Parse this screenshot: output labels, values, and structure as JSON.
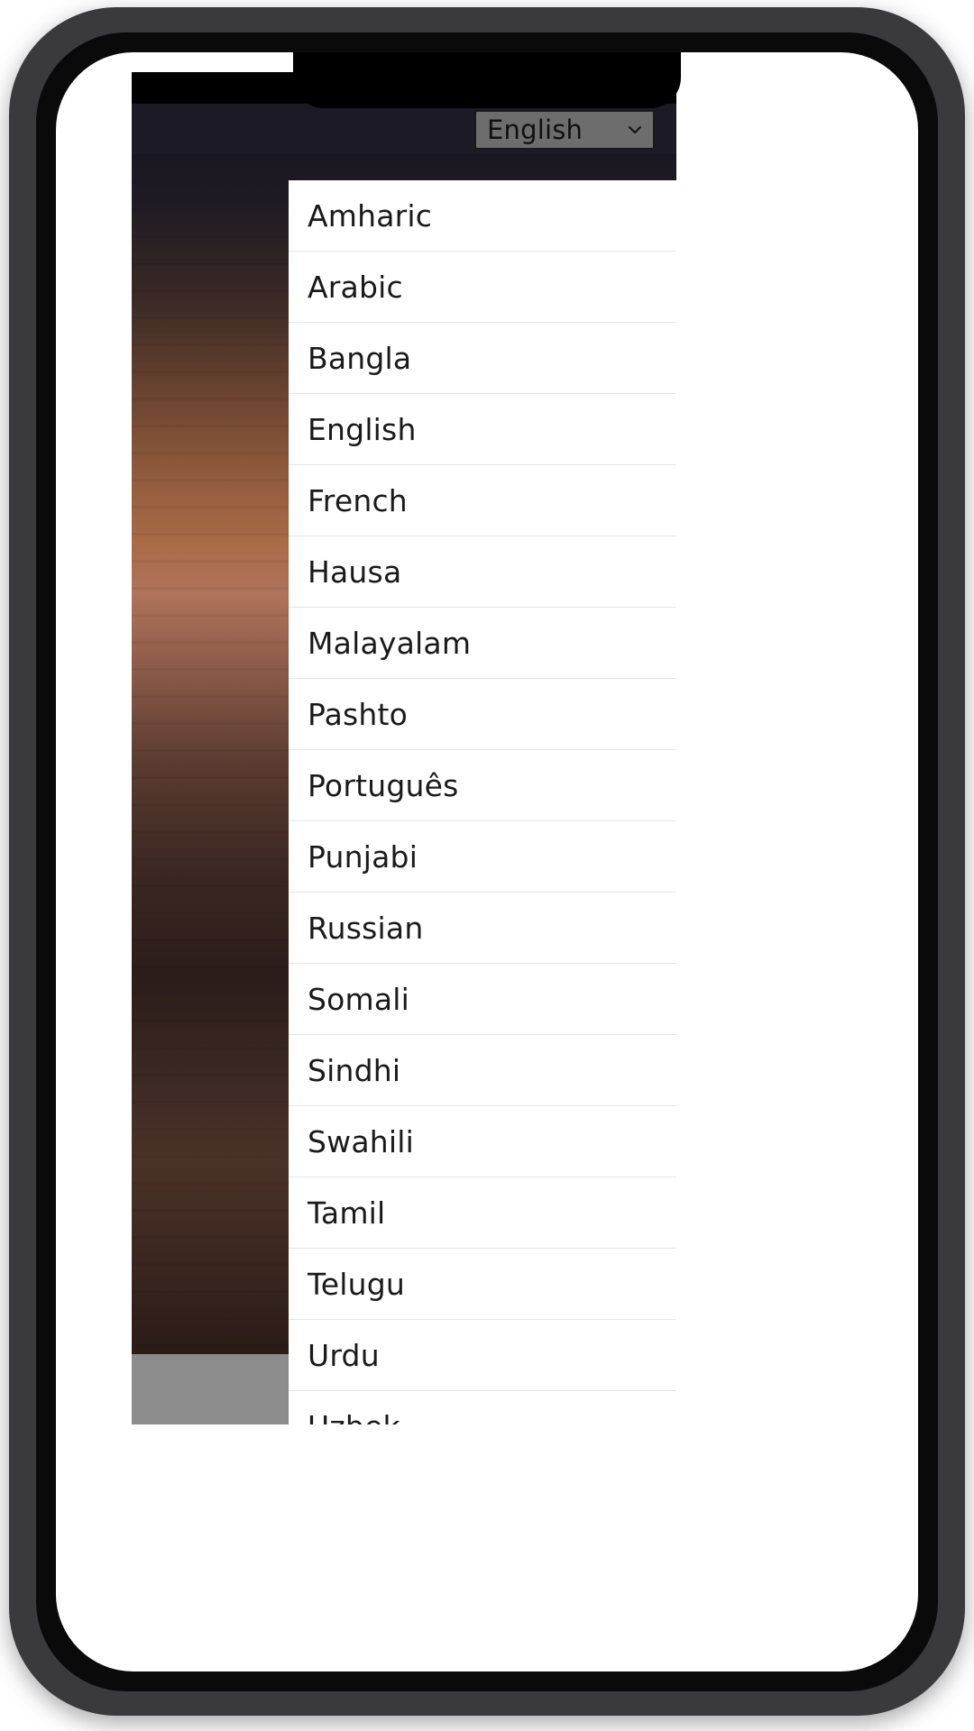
{
  "device": {
    "type": "smartphone-mockup",
    "frame_color": "#3a3a3c",
    "screen_color": "#ffffff"
  },
  "app": {
    "header_color": "#1b1a25",
    "navbar_color": "#8c8c8c",
    "wallpaper": "dark wooden desk / desert photo wallpaper"
  },
  "language_select": {
    "name": "language-dropdown",
    "value": "English",
    "icon": "chevron-down-icon",
    "expanded": true
  },
  "language_list": {
    "selected": "English",
    "accent_color": "#00806b",
    "items": [
      {
        "label": "Amharic",
        "selected": false
      },
      {
        "label": "Arabic",
        "selected": false
      },
      {
        "label": "Bangla",
        "selected": false
      },
      {
        "label": "English",
        "selected": true
      },
      {
        "label": "French",
        "selected": false
      },
      {
        "label": "Hausa",
        "selected": false
      },
      {
        "label": "Malayalam",
        "selected": false
      },
      {
        "label": "Pashto",
        "selected": false
      },
      {
        "label": "Português",
        "selected": false
      },
      {
        "label": "Punjabi",
        "selected": false
      },
      {
        "label": "Russian",
        "selected": false
      },
      {
        "label": "Somali",
        "selected": false
      },
      {
        "label": "Sindhi",
        "selected": false
      },
      {
        "label": "Swahili",
        "selected": false
      },
      {
        "label": "Tamil",
        "selected": false
      },
      {
        "label": "Telugu",
        "selected": false
      },
      {
        "label": "Urdu",
        "selected": false
      },
      {
        "label": "Uzbek",
        "selected": false
      }
    ]
  }
}
